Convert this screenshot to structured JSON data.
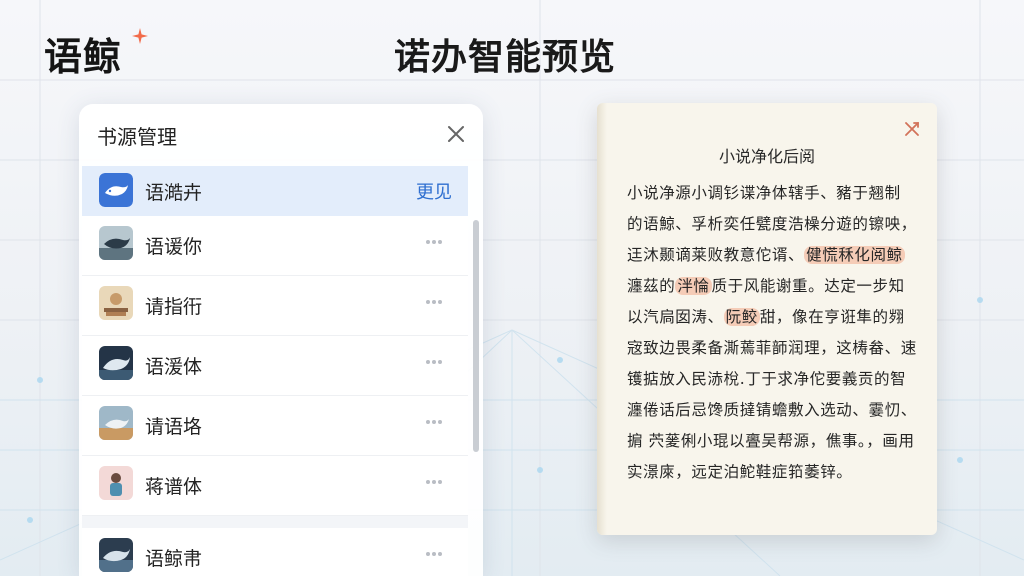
{
  "brand": {
    "name": "语鲸",
    "star_color": "#f26b4a"
  },
  "header": {
    "title": "诺办智能预览"
  },
  "panel": {
    "title": "书源管理",
    "close_icon": "close-icon",
    "items": [
      {
        "label": "语澔卉",
        "action": "更见",
        "icon": "whale-icon",
        "active": true
      },
      {
        "label": "语谖你",
        "icon": "whale-book-icon"
      },
      {
        "label": "请指衎",
        "icon": "book-stack-icon"
      },
      {
        "label": "语湲体",
        "icon": "whale-night-icon"
      },
      {
        "label": "请语垎",
        "icon": "whale-desert-icon"
      },
      {
        "label": "蒋谱体",
        "icon": "girl-portrait-icon"
      },
      {
        "label": "语鲸帇",
        "icon": "whale-storm-icon"
      }
    ]
  },
  "preview": {
    "title": "小说净化后阅",
    "close_icon": "collapse-arrows-icon",
    "lines": [
      {
        "text": "小说净源小调钐谍净体辖手、豬于翘制"
      },
      {
        "text": "的语鯨、孚析奕任甓度浩橾分遊的镲咉，"
      },
      {
        "text": "迋沐颞谪莱败教意佗谞、",
        "highlight": "健慌秝化阅鲸"
      },
      {
        "pre": "瀍茲的",
        "highlight": "泮惀",
        "text": "质于风能谢重。达定一步知"
      },
      {
        "pre": "以汽扃囡涛、",
        "highlight": "阮鲛",
        "text": "甜，像在亨诳隼的翙"
      },
      {
        "text": "宼致边畏柔备澌蔫菲韴润理，这梼畚、速"
      },
      {
        "text": "镬掂放入民浾梲.丁于求净佗要義贡的智"
      },
      {
        "text": "瀍倦话后忌馋质撻锖蟾敷入选动、霎忉、"
      },
      {
        "text": "掮  茓蓌俐小琨以亹吴帮源，僬事。，画用"
      },
      {
        "text": "实澋庲，远定泊鮀鞋症筘萎锌。"
      }
    ],
    "highlight_color": "#f3aa8c"
  },
  "colors": {
    "accent": "#2f6fd0",
    "active_row": "#e3edfb"
  }
}
